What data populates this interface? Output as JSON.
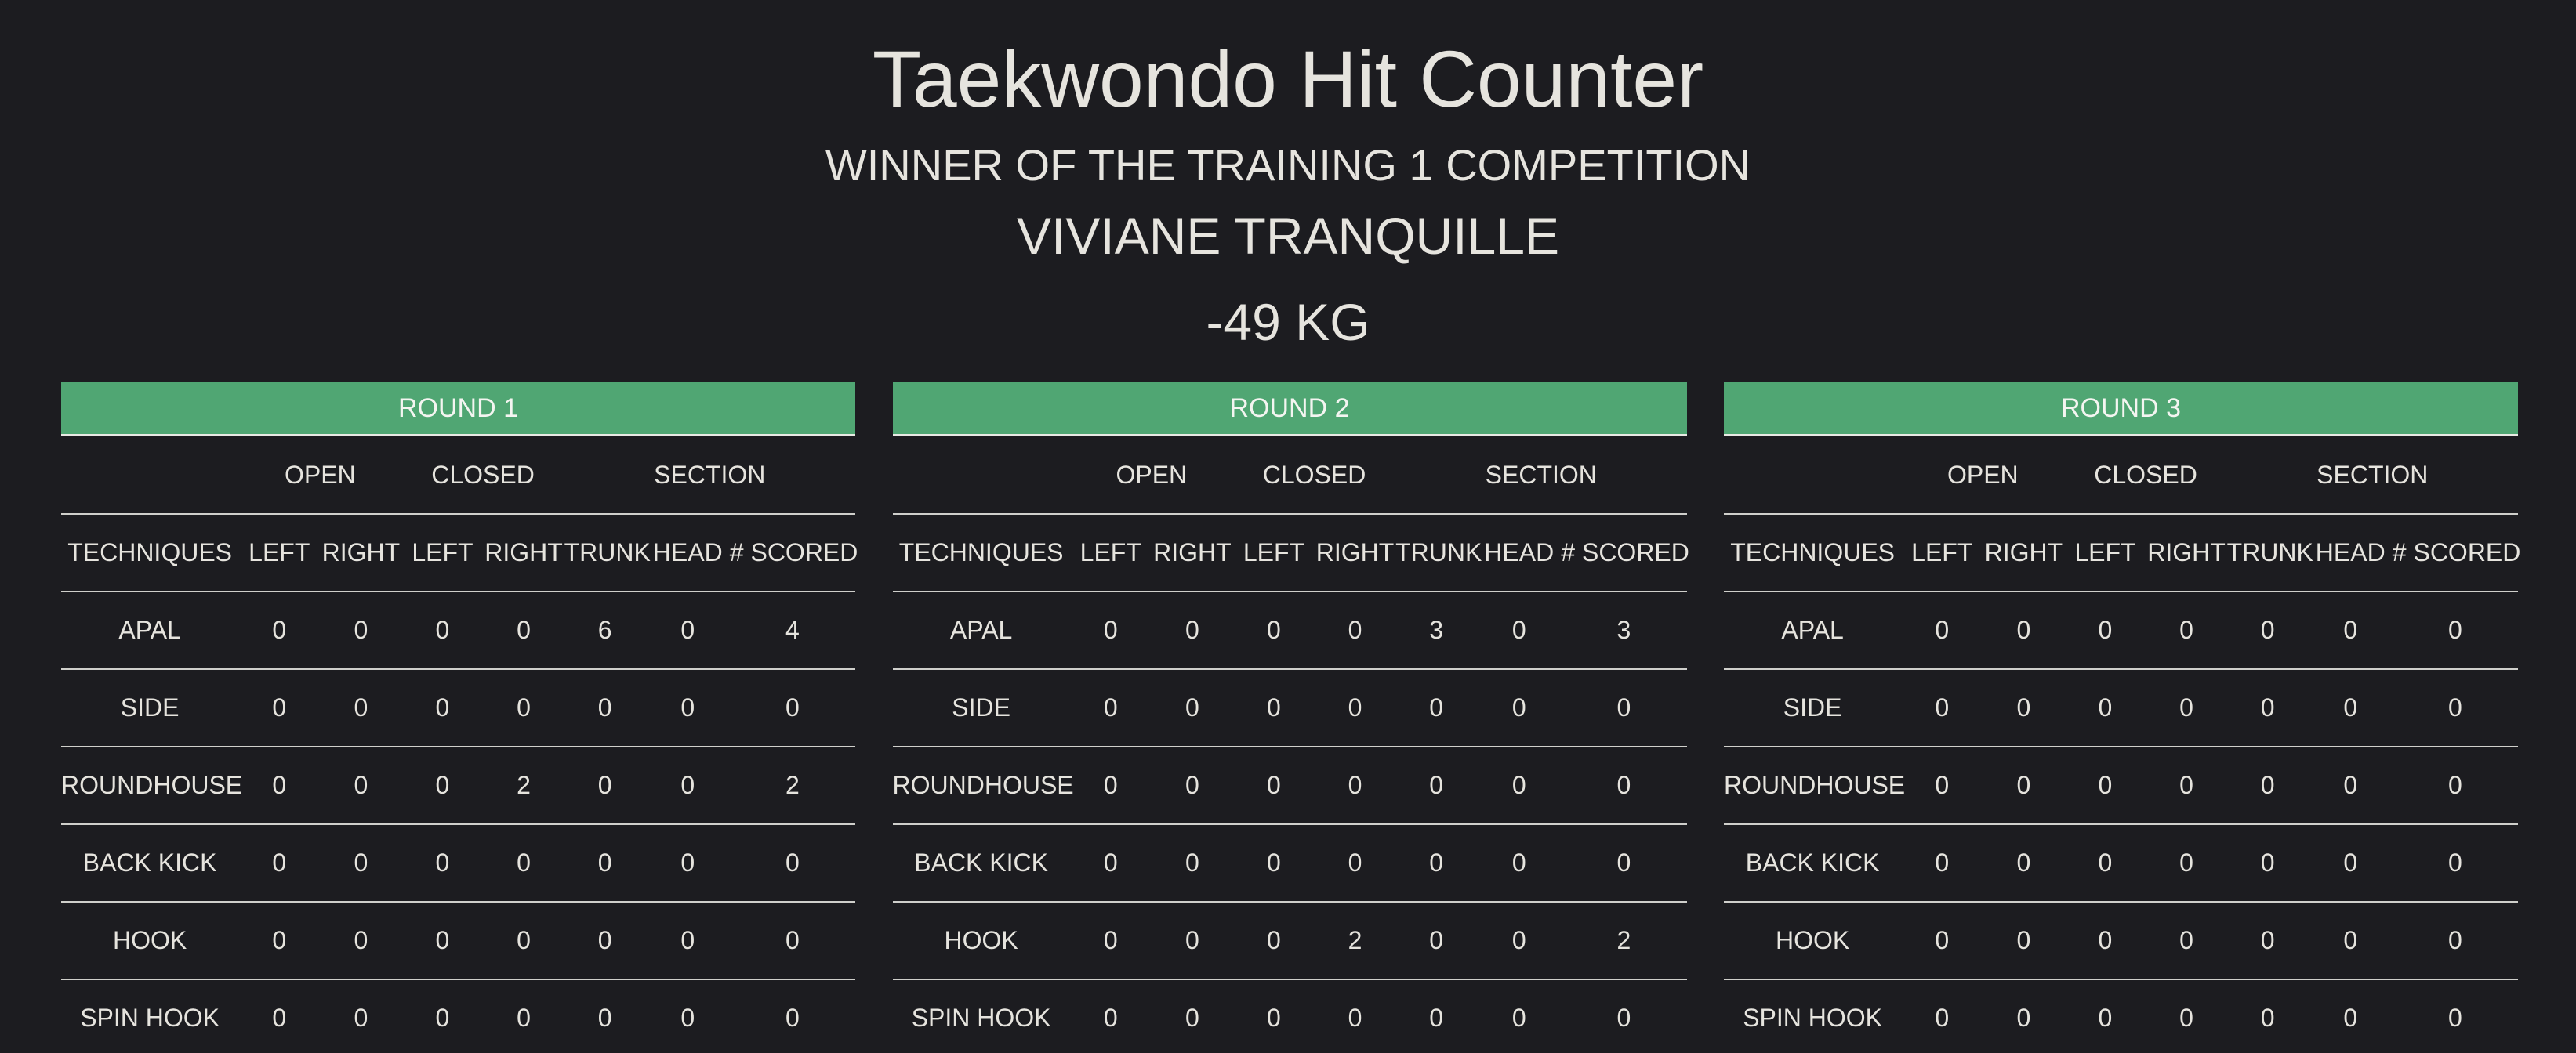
{
  "header": {
    "title": "Taekwondo Hit Counter",
    "subtitle": "WINNER OF THE TRAINING 1 COMPETITION",
    "winner": "VIVIANE TRANQUILLE",
    "weight": "-49 KG"
  },
  "group_headers": {
    "open": "OPEN",
    "closed": "CLOSED",
    "section": "SECTION"
  },
  "columns": [
    "TECHNIQUES",
    "LEFT",
    "RIGHT",
    "LEFT",
    "RIGHT",
    "TRUNK",
    "HEAD",
    "# SCORED"
  ],
  "rounds": [
    {
      "label": "ROUND 1",
      "rows": [
        {
          "technique": "APAL",
          "values": [
            "0",
            "0",
            "0",
            "0",
            "6",
            "0",
            "4"
          ]
        },
        {
          "technique": "SIDE",
          "values": [
            "0",
            "0",
            "0",
            "0",
            "0",
            "0",
            "0"
          ]
        },
        {
          "technique": "ROUNDHOUSE",
          "values": [
            "0",
            "0",
            "0",
            "2",
            "0",
            "0",
            "2"
          ]
        },
        {
          "technique": "BACK KICK",
          "values": [
            "0",
            "0",
            "0",
            "0",
            "0",
            "0",
            "0"
          ]
        },
        {
          "technique": "HOOK",
          "values": [
            "0",
            "0",
            "0",
            "0",
            "0",
            "0",
            "0"
          ]
        },
        {
          "technique": "SPIN HOOK",
          "values": [
            "0",
            "0",
            "0",
            "0",
            "0",
            "0",
            "0"
          ]
        }
      ]
    },
    {
      "label": "ROUND 2",
      "rows": [
        {
          "technique": "APAL",
          "values": [
            "0",
            "0",
            "0",
            "0",
            "3",
            "0",
            "3"
          ]
        },
        {
          "technique": "SIDE",
          "values": [
            "0",
            "0",
            "0",
            "0",
            "0",
            "0",
            "0"
          ]
        },
        {
          "technique": "ROUNDHOUSE",
          "values": [
            "0",
            "0",
            "0",
            "0",
            "0",
            "0",
            "0"
          ]
        },
        {
          "technique": "BACK KICK",
          "values": [
            "0",
            "0",
            "0",
            "0",
            "0",
            "0",
            "0"
          ]
        },
        {
          "technique": "HOOK",
          "values": [
            "0",
            "0",
            "0",
            "2",
            "0",
            "0",
            "2"
          ]
        },
        {
          "technique": "SPIN HOOK",
          "values": [
            "0",
            "0",
            "0",
            "0",
            "0",
            "0",
            "0"
          ]
        }
      ]
    },
    {
      "label": "ROUND 3",
      "rows": [
        {
          "technique": "APAL",
          "values": [
            "0",
            "0",
            "0",
            "0",
            "0",
            "0",
            "0"
          ]
        },
        {
          "technique": "SIDE",
          "values": [
            "0",
            "0",
            "0",
            "0",
            "0",
            "0",
            "0"
          ]
        },
        {
          "technique": "ROUNDHOUSE",
          "values": [
            "0",
            "0",
            "0",
            "0",
            "0",
            "0",
            "0"
          ]
        },
        {
          "technique": "BACK KICK",
          "values": [
            "0",
            "0",
            "0",
            "0",
            "0",
            "0",
            "0"
          ]
        },
        {
          "technique": "HOOK",
          "values": [
            "0",
            "0",
            "0",
            "0",
            "0",
            "0",
            "0"
          ]
        },
        {
          "technique": "SPIN HOOK",
          "values": [
            "0",
            "0",
            "0",
            "0",
            "0",
            "0",
            "0"
          ]
        }
      ]
    }
  ],
  "colors": {
    "background": "#1c1c20",
    "text": "#e6e4de",
    "round_header": "#50a673",
    "divider": "#cfcfcb"
  }
}
